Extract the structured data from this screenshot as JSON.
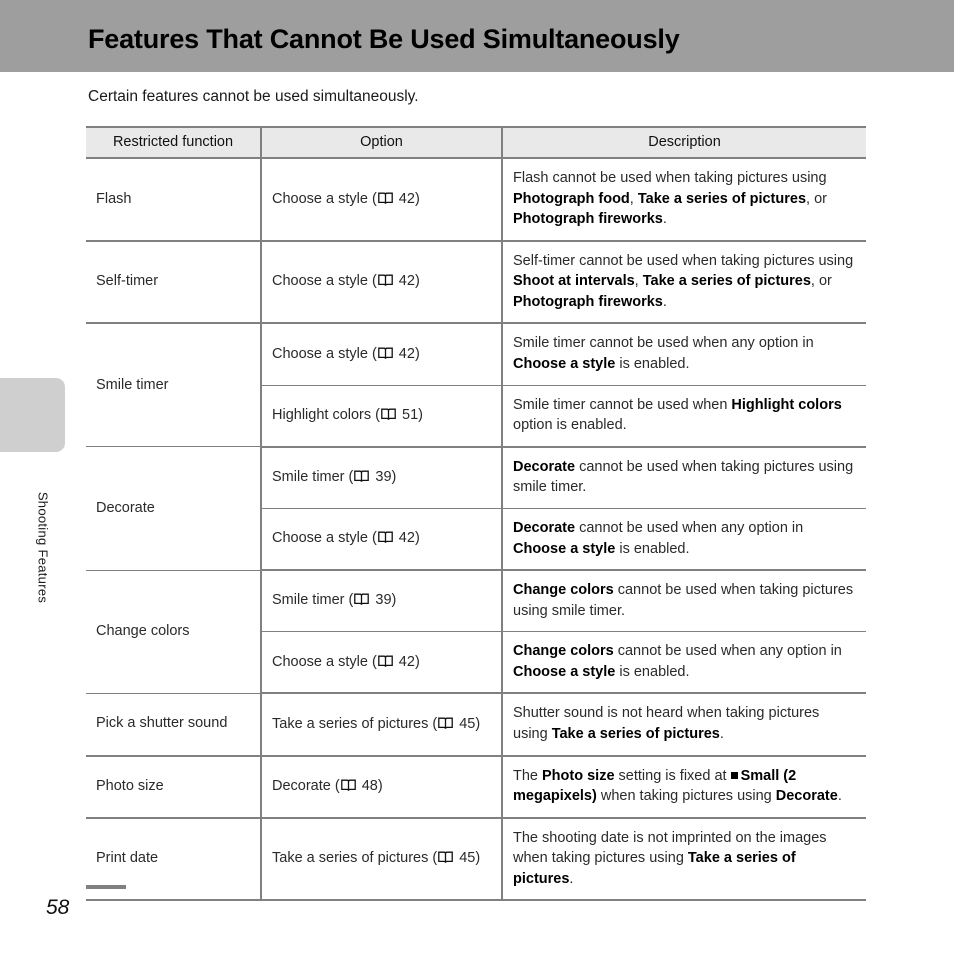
{
  "header": {
    "title": "Features That Cannot Be Used Simultaneously"
  },
  "side_tab": {
    "label": "Shooting Features"
  },
  "intro": "Certain features cannot be used simultaneously.",
  "table": {
    "columns": [
      "Restricted function",
      "Option",
      "Description"
    ],
    "rows": [
      {
        "function": "Flash",
        "entries": [
          {
            "option": "Choose a style (",
            "option_page": "42)",
            "description_parts": [
              {
                "text": "Flash cannot be used when taking pictures using ",
                "bold": false
              },
              {
                "text": "Photograph food",
                "bold": true
              },
              {
                "text": ", ",
                "bold": false
              },
              {
                "text": "Take a series of pictures",
                "bold": true
              },
              {
                "text": ", or ",
                "bold": false
              },
              {
                "text": "Photograph fireworks",
                "bold": true
              },
              {
                "text": ".",
                "bold": false
              }
            ]
          }
        ]
      },
      {
        "function": "Self-timer",
        "entries": [
          {
            "option": "Choose a style (",
            "option_page": "42)",
            "description_parts": [
              {
                "text": "Self-timer cannot be used when taking pictures using ",
                "bold": false
              },
              {
                "text": "Shoot at intervals",
                "bold": true
              },
              {
                "text": ", ",
                "bold": false
              },
              {
                "text": "Take a series of pictures",
                "bold": true
              },
              {
                "text": ", or ",
                "bold": false
              },
              {
                "text": "Photograph fireworks",
                "bold": true
              },
              {
                "text": ".",
                "bold": false
              }
            ]
          }
        ]
      },
      {
        "function": "Smile timer",
        "entries": [
          {
            "option": "Choose a style (",
            "option_page": "42)",
            "description_parts": [
              {
                "text": "Smile timer cannot be used when any option in ",
                "bold": false
              },
              {
                "text": "Choose a style",
                "bold": true
              },
              {
                "text": " is enabled.",
                "bold": false
              }
            ]
          },
          {
            "option": "Highlight colors (",
            "option_page": "51)",
            "description_parts": [
              {
                "text": "Smile timer cannot be used when ",
                "bold": false
              },
              {
                "text": "Highlight colors",
                "bold": true
              },
              {
                "text": " option is enabled.",
                "bold": false
              }
            ]
          }
        ]
      },
      {
        "function": "Decorate",
        "entries": [
          {
            "option": "Smile timer (",
            "option_page": "39)",
            "description_parts": [
              {
                "text": "Decorate",
                "bold": true
              },
              {
                "text": " cannot be used when taking pictures using smile timer.",
                "bold": false
              }
            ]
          },
          {
            "option": "Choose a style (",
            "option_page": "42)",
            "description_parts": [
              {
                "text": "Decorate",
                "bold": true
              },
              {
                "text": " cannot be used when any option in ",
                "bold": false
              },
              {
                "text": "Choose a style",
                "bold": true
              },
              {
                "text": " is enabled.",
                "bold": false
              }
            ]
          }
        ]
      },
      {
        "function": "Change colors",
        "entries": [
          {
            "option": "Smile timer (",
            "option_page": "39)",
            "description_parts": [
              {
                "text": "Change colors",
                "bold": true
              },
              {
                "text": " cannot be used when taking pictures using smile timer.",
                "bold": false
              }
            ]
          },
          {
            "option": "Choose a style (",
            "option_page": "42)",
            "description_parts": [
              {
                "text": "Change colors",
                "bold": true
              },
              {
                "text": " cannot be used when any option in ",
                "bold": false
              },
              {
                "text": "Choose a style",
                "bold": true
              },
              {
                "text": " is enabled.",
                "bold": false
              }
            ]
          }
        ]
      },
      {
        "function": "Pick a shutter sound",
        "entries": [
          {
            "option": "Take a series of pictures (",
            "option_page": "45)",
            "description_parts": [
              {
                "text": "Shutter sound is not heard when taking pictures using ",
                "bold": false
              },
              {
                "text": "Take a series of pictures",
                "bold": true
              },
              {
                "text": ".",
                "bold": false
              }
            ]
          }
        ]
      },
      {
        "function": "Photo size",
        "entries": [
          {
            "option": "Decorate (",
            "option_page": "48)",
            "description_parts": [
              {
                "text": "The ",
                "bold": false
              },
              {
                "text": "Photo size",
                "bold": true
              },
              {
                "text": " setting is fixed at ",
                "bold": false
              },
              {
                "text": "SQUARE_BULLET",
                "bold": false,
                "icon": "small-square-bullet"
              },
              {
                "text": "Small (2 megapixels)",
                "bold": true
              },
              {
                "text": " when taking pictures using ",
                "bold": false
              },
              {
                "text": "Decorate",
                "bold": true
              },
              {
                "text": ".",
                "bold": false
              }
            ]
          }
        ]
      },
      {
        "function": "Print date",
        "entries": [
          {
            "option": "Take a series of pictures (",
            "option_page": "45)",
            "description_parts": [
              {
                "text": "The shooting date is not imprinted on the images when taking pictures using ",
                "bold": false
              },
              {
                "text": "Take a series of pictures",
                "bold": true
              },
              {
                "text": ".",
                "bold": false
              }
            ]
          }
        ]
      }
    ]
  },
  "footer": {
    "page_number": "58"
  },
  "icons": {
    "page_ref": "open-book-icon",
    "bullet": "small-square-bullet-icon"
  },
  "colors": {
    "header_bar": "#9e9e9e",
    "side_tab": "#cfcfcf",
    "table_header_bg": "#e9e9e9",
    "rule": "#808080"
  }
}
